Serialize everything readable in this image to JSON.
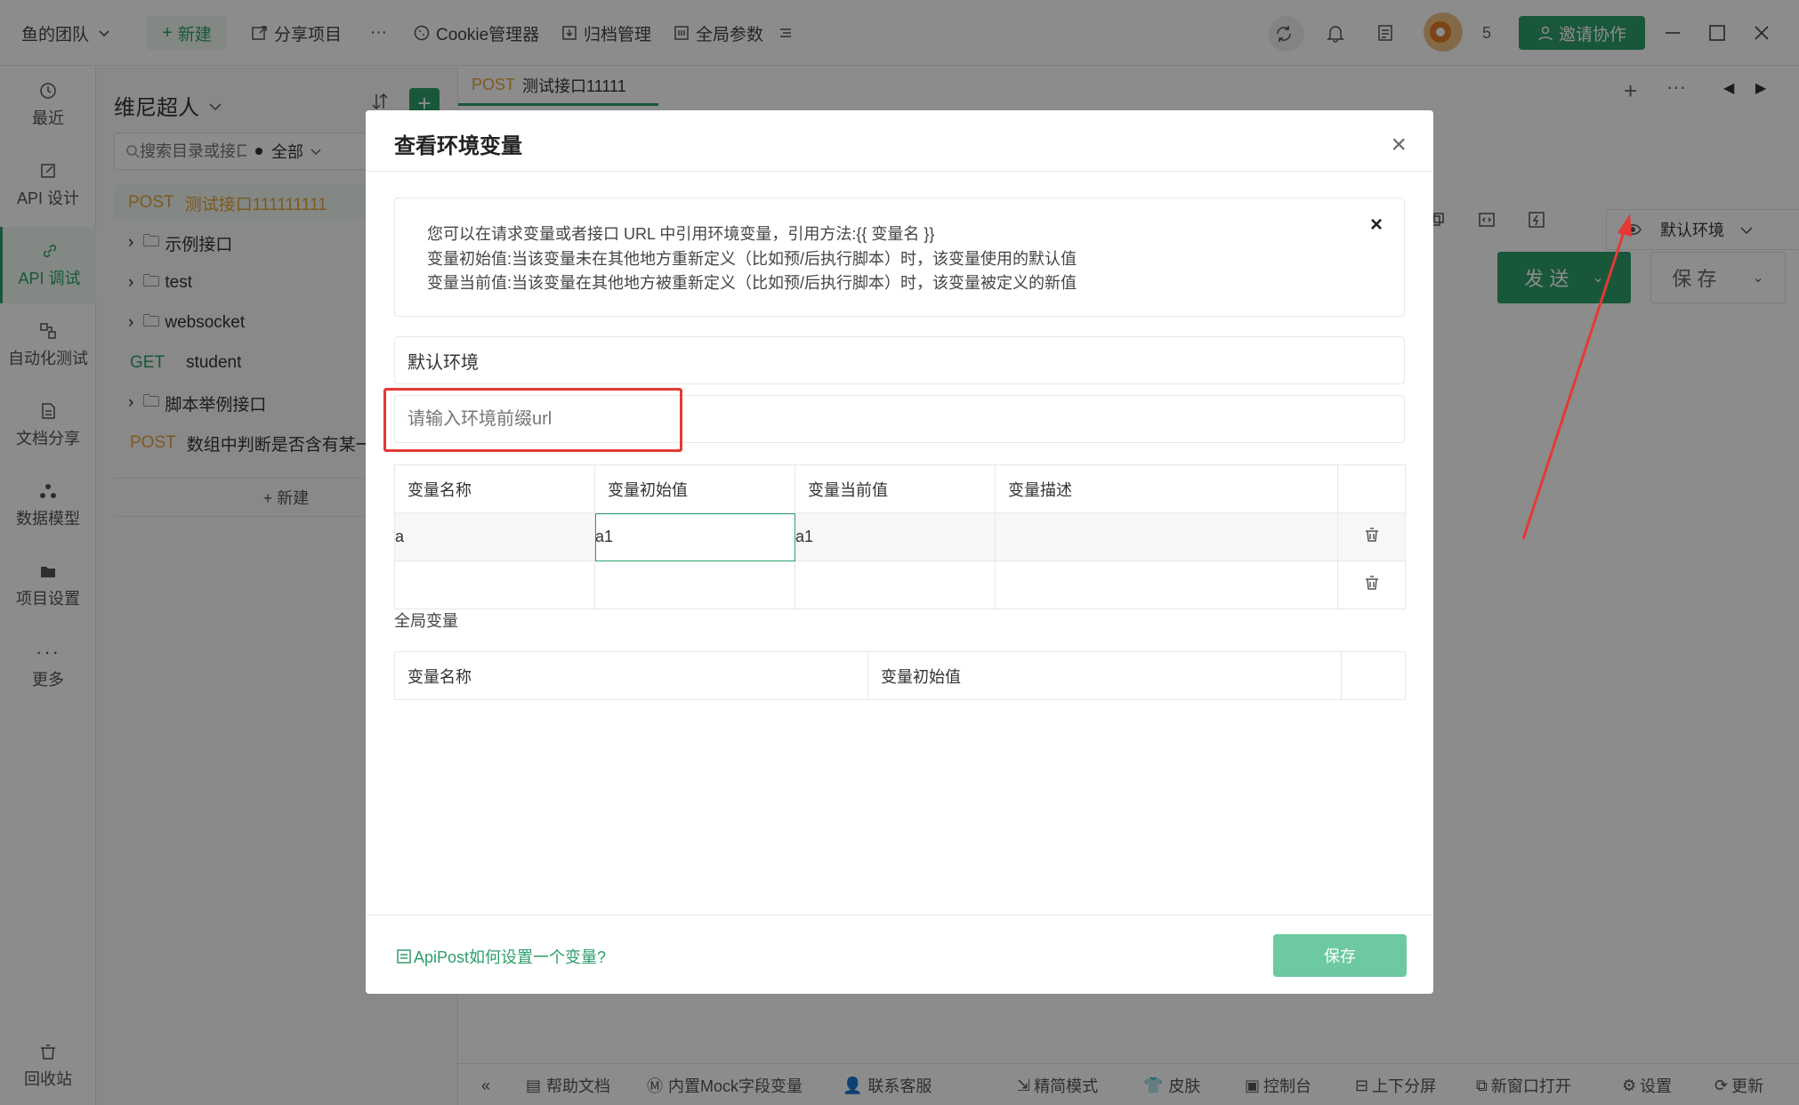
{
  "titlebar": {
    "team": "鱼的团队",
    "new_label": "新建",
    "share_label": "分享项目",
    "more_label": "···",
    "cookie_label": "Cookie管理器",
    "archive_label": "归档管理",
    "global_params_label": "全局参数",
    "badge_count": "5",
    "invite_label": "邀请协作"
  },
  "leftnav": {
    "items": [
      {
        "label": "最近"
      },
      {
        "label": "API 设计"
      },
      {
        "label": "API 调试"
      },
      {
        "label": "自动化测试"
      },
      {
        "label": "文档分享"
      },
      {
        "label": "数据模型"
      },
      {
        "label": "项目设置"
      },
      {
        "label": "更多"
      }
    ],
    "trash_label": "回收站"
  },
  "tree": {
    "project": "维尼超人",
    "search_placeholder": "搜索目录或接口",
    "filter_label": "全部",
    "items": [
      {
        "method": "POST",
        "label": "测试接口111111111"
      },
      {
        "label": "示例接口"
      },
      {
        "label": "test"
      },
      {
        "label": "websocket"
      },
      {
        "method": "GET",
        "label": "student"
      },
      {
        "label": "脚本举例接口"
      },
      {
        "method": "POST",
        "label": "数组中判断是否含有某一个"
      }
    ],
    "add_label": "+ 新建"
  },
  "main": {
    "tab_method": "POST",
    "tab_title": "测试接口11111",
    "env_label": "默认环境",
    "send_label": "发 送",
    "save_label": "保 存"
  },
  "bottombar": {
    "items": [
      "帮助文档",
      "内置Mock字段变量",
      "联系客服",
      "精简模式",
      "皮肤",
      "控制台",
      "上下分屏",
      "新窗口打开",
      "设置",
      "更新"
    ]
  },
  "modal": {
    "title": "查看环境变量",
    "close": "×",
    "notice_lines": [
      "您可以在请求变量或者接口 URL 中引用环境变量，引用方法:{{ 变量名 }}",
      "变量初始值:当该变量未在其他地方重新定义（比如预/后执行脚本）时，该变量使用的默认值",
      "变量当前值:当该变量在其他地方被重新定义（比如预/后执行脚本）时，该变量被定义的新值"
    ],
    "notice_close": "×",
    "env_name": "默认环境",
    "url_placeholder": "请输入环境前缀url",
    "env_table": {
      "headers": [
        "变量名称",
        "变量初始值",
        "变量当前值",
        "变量描述"
      ],
      "rows": [
        {
          "name": "a",
          "initial": "a1",
          "current": "a1",
          "desc": ""
        },
        {
          "name": "",
          "initial": "",
          "current": "",
          "desc": ""
        }
      ]
    },
    "global_label": "全局变量",
    "global_table": {
      "headers": [
        "变量名称",
        "变量初始值"
      ]
    },
    "help_link": "ApiPost如何设置一个变量?",
    "save_label": "保存"
  },
  "colors": {
    "accent": "#2e9e6b",
    "save_button": "#6cc9a0",
    "annotation_red": "#e53935",
    "post_method": "#e6a23c"
  }
}
